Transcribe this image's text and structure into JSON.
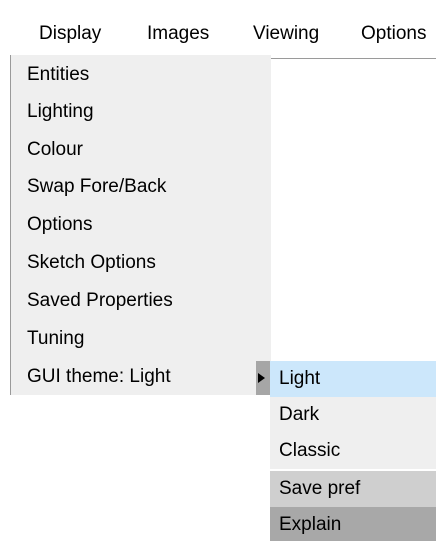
{
  "menubar": {
    "items": [
      {
        "label": "Display"
      },
      {
        "label": "Images"
      },
      {
        "label": "Viewing"
      },
      {
        "label": "Options"
      }
    ]
  },
  "display_menu": {
    "items": [
      {
        "label": "Entities"
      },
      {
        "label": "Lighting"
      },
      {
        "label": "Colour"
      },
      {
        "label": "Swap Fore/Back"
      },
      {
        "label": "Options"
      },
      {
        "label": "Sketch Options"
      },
      {
        "label": "Saved Properties"
      },
      {
        "label": "Tuning"
      },
      {
        "label": "GUI theme: Light"
      }
    ]
  },
  "theme_submenu": {
    "items": [
      {
        "label": "Light"
      },
      {
        "label": "Dark"
      },
      {
        "label": "Classic"
      },
      {
        "label": "Save pref"
      },
      {
        "label": "Explain"
      }
    ]
  },
  "colors": {
    "menu_background": "#efefef",
    "highlight": "#cce7fb",
    "save_pref_background": "#cfcfcf",
    "explain_background": "#a8a8a8",
    "arrow_box": "#a6a6a6"
  },
  "icons": {
    "submenu_arrow": "triangle-right-icon"
  }
}
